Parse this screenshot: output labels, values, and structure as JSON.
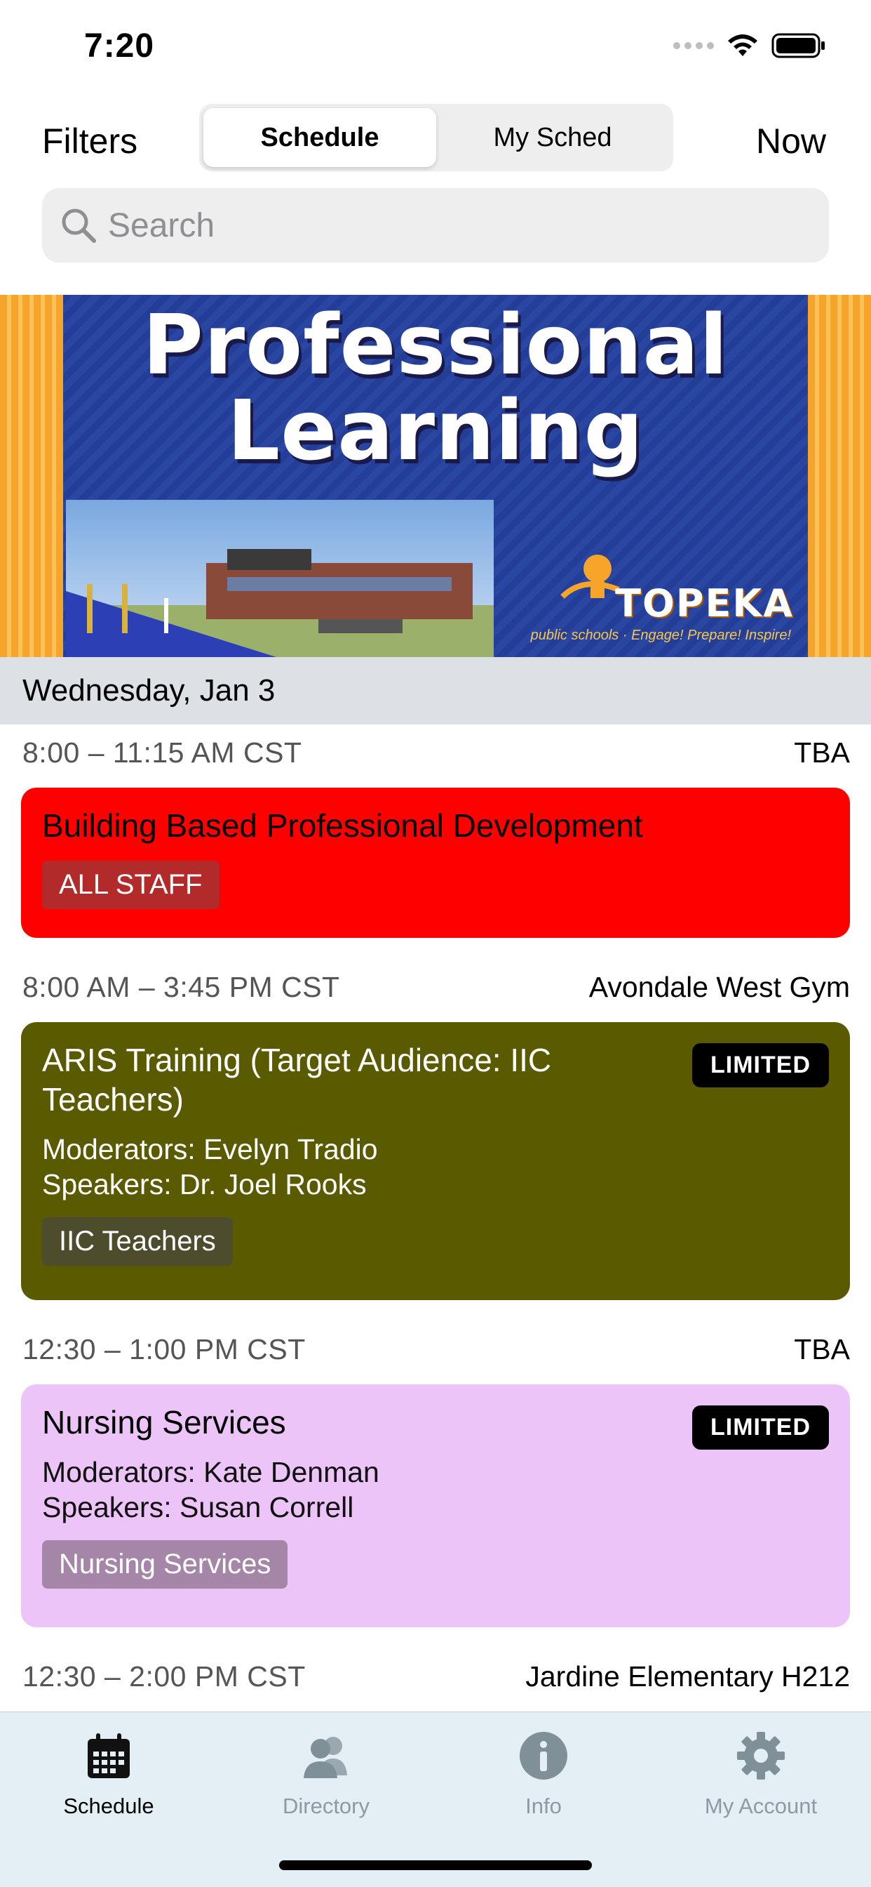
{
  "status_bar": {
    "time": "7:20"
  },
  "nav": {
    "filters_label": "Filters",
    "now_label": "Now",
    "segments": [
      {
        "label": "Schedule",
        "active": true
      },
      {
        "label": "My Sched",
        "active": false
      }
    ]
  },
  "search": {
    "placeholder": "Search",
    "value": ""
  },
  "banner": {
    "title_line1": "Professional",
    "title_line2": "Learning",
    "logo_text": "TOPEKA",
    "logo_subtext": "public schools",
    "logo_tagline": "Engage! Prepare! Inspire!"
  },
  "date_header": "Wednesday, Jan 3",
  "sessions": [
    {
      "time": "8:00 – 11:15 AM CST",
      "room": "TBA",
      "title": "Building Based Professional Development",
      "moderators": "",
      "speakers": "",
      "tag": "ALL STAFF",
      "limited": "",
      "card_color": "#ff0000",
      "tag_color": "#b22a2a"
    },
    {
      "time": "8:00 AM – 3:45 PM CST",
      "room": "Avondale West Gym",
      "title": "ARIS Training (Target Audience: IIC Teachers)",
      "moderators": "Moderators: Evelyn Tradio",
      "speakers": "Speakers: Dr. Joel Rooks",
      "tag": "IIC Teachers",
      "limited": "LIMITED",
      "card_color": "#5a5a00",
      "tag_color": "#4d4d2e"
    },
    {
      "time": "12:30 – 1:00 PM CST",
      "room": "TBA",
      "title": "Nursing Services",
      "moderators": "Moderators: Kate Denman",
      "speakers": "Speakers: Susan Correll",
      "tag": "Nursing Services",
      "limited": "LIMITED",
      "card_color": "#ecc4f8",
      "tag_color": "#a586a8"
    },
    {
      "time": "12:30 – 2:00 PM CST",
      "room": "Jardine Elementary H212"
    }
  ],
  "tab_bar": {
    "items": [
      {
        "label": "Schedule",
        "icon": "calendar-icon",
        "active": true
      },
      {
        "label": "Directory",
        "icon": "people-icon",
        "active": false
      },
      {
        "label": "Info",
        "icon": "info-icon",
        "active": false
      },
      {
        "label": "My Account",
        "icon": "gear-icon",
        "active": false
      }
    ]
  }
}
